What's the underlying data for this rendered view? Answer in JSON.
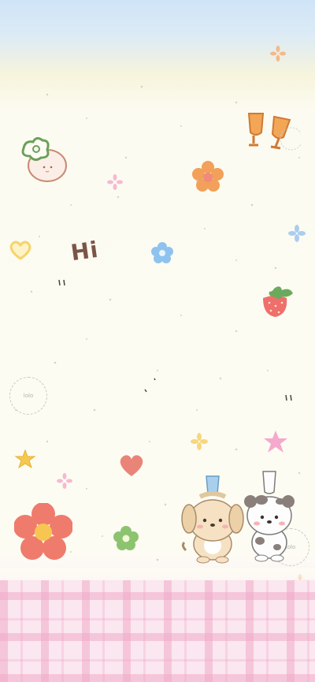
{
  "greeting": {
    "text": "Hi"
  },
  "stamp": {
    "text": "lolo"
  },
  "palette": {
    "sky": "#cfe4f7",
    "paper": "#fdfcf3",
    "plaid_pink": "#fbe7ef",
    "flower_orange": "#f2a05a",
    "flower_red": "#ef7b6c",
    "flower_green": "#8cc36f",
    "flower_blue": "#8ec3ef",
    "heart_yellow": "#f5d46c",
    "heart_red": "#e98578",
    "star_pink": "#f5a9cc",
    "star_yellow": "#f5c94d"
  }
}
